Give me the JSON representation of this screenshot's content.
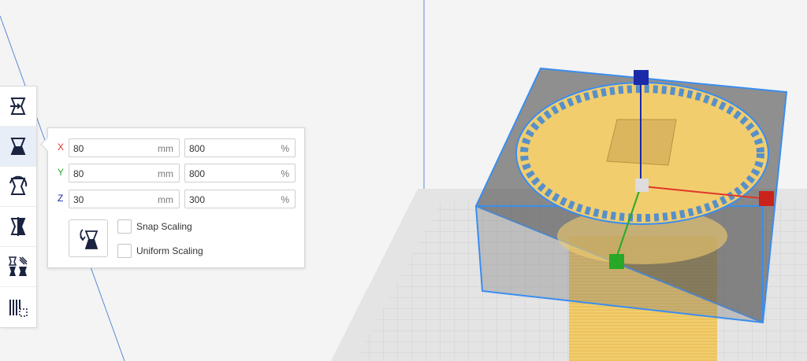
{
  "colors": {
    "accent": "#3a8df0",
    "axis_x": "#e0362a",
    "axis_y": "#27a827",
    "axis_z": "#1b2aa8",
    "model_yellow": "#f2cd6e",
    "support_blue": "#2f80e0",
    "panel_bg": "#ffffff"
  },
  "toolbar": {
    "tools": [
      {
        "icon": "move-icon",
        "active": false
      },
      {
        "icon": "scale-icon",
        "active": true
      },
      {
        "icon": "rotate-icon",
        "active": false
      },
      {
        "icon": "mirror-icon",
        "active": false
      },
      {
        "icon": "per-model-settings-icon",
        "active": false
      },
      {
        "icon": "support-blocker-icon",
        "active": false
      }
    ]
  },
  "scale_panel": {
    "rows": [
      {
        "axis": "X",
        "mm": "80",
        "mm_unit": "mm",
        "percent": "800",
        "percent_unit": "%"
      },
      {
        "axis": "Y",
        "mm": "80",
        "mm_unit": "mm",
        "percent": "800",
        "percent_unit": "%"
      },
      {
        "axis": "Z",
        "mm": "30",
        "mm_unit": "mm",
        "percent": "300",
        "percent_unit": "%"
      }
    ],
    "lay_flat_icon": "lay-flat-icon",
    "snap_scaling": {
      "label": "Snap Scaling",
      "checked": false
    },
    "uniform_scaling": {
      "label": "Uniform Scaling",
      "checked": false
    }
  }
}
